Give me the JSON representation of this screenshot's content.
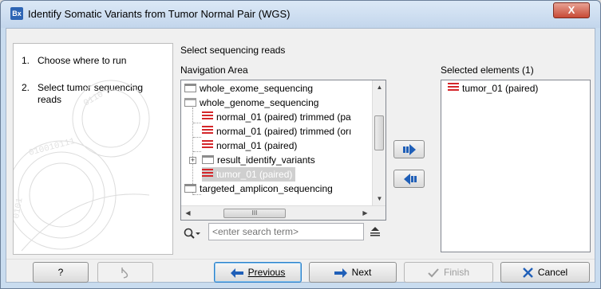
{
  "window": {
    "icon_text": "Bx",
    "title": "Identify Somatic Variants from Tumor Normal Pair (WGS)",
    "close_glyph": "X"
  },
  "steps": [
    {
      "num": "1.",
      "label": "Choose where to run"
    },
    {
      "num": "2.",
      "label": "Select tumor sequencing reads"
    }
  ],
  "section_title": "Select sequencing reads",
  "navigation": {
    "title": "Navigation Area",
    "items": [
      {
        "label": "whole_exome_sequencing",
        "type": "folder"
      },
      {
        "label": "whole_genome_sequencing",
        "type": "folder-open"
      },
      {
        "label": "normal_01 (paired) trimmed (pa",
        "type": "sequence"
      },
      {
        "label": "normal_01 (paired) trimmed (orı",
        "type": "sequence"
      },
      {
        "label": "normal_01 (paired)",
        "type": "sequence"
      },
      {
        "label": "result_identify_variants",
        "type": "folder"
      },
      {
        "label": "tumor_01 (paired)",
        "type": "sequence",
        "selected": true
      },
      {
        "label": "targeted_amplicon_sequencing",
        "type": "folder"
      }
    ],
    "expander_glyph": "+",
    "hscroll_grip": "III"
  },
  "selected": {
    "title": "Selected elements (1)",
    "items": [
      {
        "label": "tumor_01 (paired)",
        "type": "sequence"
      }
    ]
  },
  "search": {
    "placeholder": "<enter search term>"
  },
  "buttons": {
    "help": "?",
    "previous": "Previous",
    "next": "Next",
    "finish": "Finish",
    "cancel": "Cancel"
  },
  "colors": {
    "accent_blue": "#1f5fb8",
    "sequence_red": "#d4262a"
  }
}
